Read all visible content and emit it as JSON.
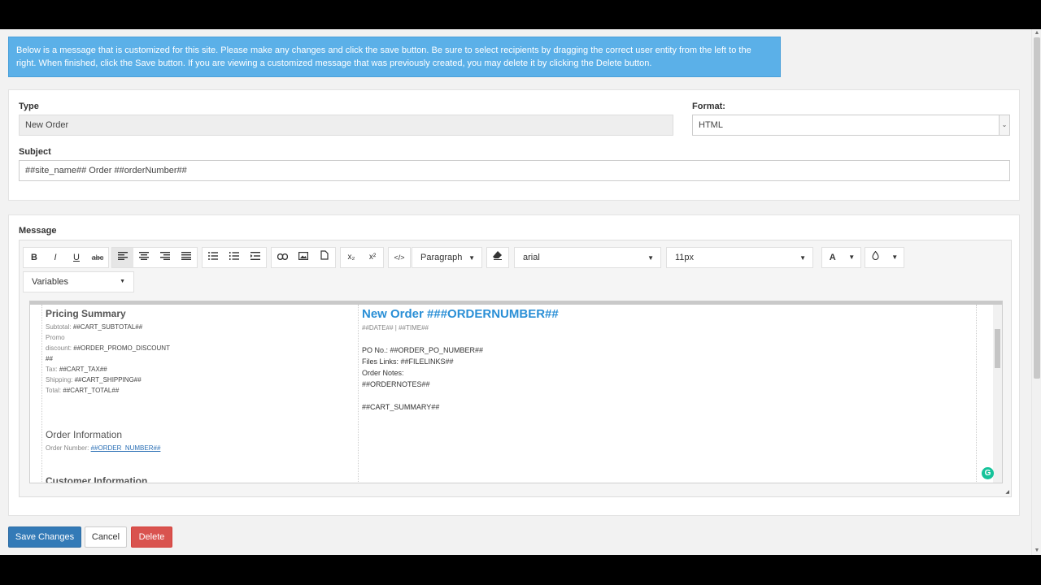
{
  "info_message": "Below is a message that is customized for this site. Please make any changes and click the save button. Be sure to select recipients by dragging the correct user entity from the left to the right. When finished, click the Save button. If you are viewing a customized message that was previously created, you may delete it by clicking the Delete button.",
  "form": {
    "type_label": "Type",
    "type_value": "New Order",
    "format_label": "Format:",
    "format_value": "HTML",
    "subject_label": "Subject",
    "subject_value": "##site_name## Order ##orderNumber##"
  },
  "message": {
    "label": "Message",
    "toolbar": {
      "bold": "B",
      "italic": "I",
      "underline": "U",
      "strike": "abc",
      "subscript": "x₂",
      "superscript": "x²",
      "code": "</>",
      "paragraph": "Paragraph",
      "font": "arial",
      "size": "11px",
      "font_color": "A",
      "variables": "Variables"
    },
    "left": {
      "pricing_title": "Pricing Summary",
      "lines": [
        {
          "label": "Subtotal:",
          "value": "##CART_SUBTOTAL##"
        },
        {
          "label": "Promo",
          "value": ""
        },
        {
          "label": "discount:",
          "value": "##ORDER_PROMO_DISCOUNT"
        },
        {
          "label": "",
          "value": "##"
        },
        {
          "label": "Tax:",
          "value": "##CART_TAX##"
        },
        {
          "label": "Shipping:",
          "value": "##CART_SHIPPING##"
        },
        {
          "label": "Total:",
          "value": "##CART_TOTAL##"
        }
      ],
      "order_info_title": "Order Information",
      "order_number_label": "Order Number:",
      "order_number_value": "##ORDER_NUMBER##",
      "customer_info_title": "Customer Information"
    },
    "right": {
      "title": "New Order ###ORDERNUMBER##",
      "date_line": "##DATE## | ##TIME##",
      "po_line": "PO No.: ##ORDER_PO_NUMBER##",
      "files_line": "Files Links: ##FILELINKS##",
      "notes_label": "Order Notes:",
      "notes_value": "##ORDERNOTES##",
      "cart_summary": "##CART_SUMMARY##"
    }
  },
  "buttons": {
    "save": "Save Changes",
    "cancel": "Cancel",
    "delete": "Delete"
  },
  "colors": {
    "info_bg": "#5bb0e8",
    "primary": "#337ab7",
    "danger": "#d9534f",
    "title_blue": "#2a8fd6"
  }
}
